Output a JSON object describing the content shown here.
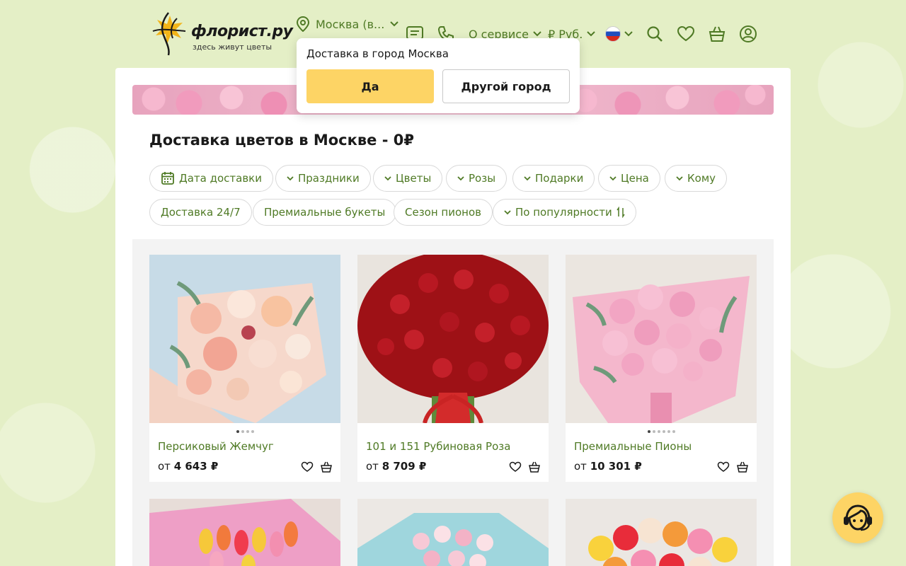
{
  "header": {
    "logo_text": "флорист.ру",
    "logo_tagline": "здесь живут цветы",
    "city_label": "Москва (в...",
    "about_label": "О сервисе",
    "currency_label": "₽ Руб."
  },
  "popup": {
    "question": "Доставка в город Москва",
    "yes_label": "Да",
    "other_label": "Другой город"
  },
  "main": {
    "title": "Доставка цветов в Москве - 0₽"
  },
  "filters": {
    "row1": [
      "Дата доставки",
      "Праздники",
      "Цветы",
      "Розы",
      "Подарки",
      "Цена",
      "Кому"
    ],
    "row2": [
      "Доставка 24/7",
      "Премиальные букеты",
      "Сезон пионов",
      "По популярности"
    ]
  },
  "products": [
    {
      "name": "Персиковый Жемчуг",
      "price_prefix": "от",
      "price": "4 643 ₽"
    },
    {
      "name": "101 и 151 Рубиновая Роза",
      "price_prefix": "от",
      "price": "8 709 ₽"
    },
    {
      "name": "Премиальные Пионы",
      "price_prefix": "от",
      "price": "10 301 ₽"
    }
  ],
  "colors": {
    "accent_green": "#4f7a25",
    "button_yellow": "#fdd465",
    "page_bg": "#e4efc6"
  },
  "icons": [
    "location-pin-icon",
    "chevron-down-icon",
    "chat-icon",
    "phone-icon",
    "flag-ru-icon",
    "search-icon",
    "heart-icon",
    "basket-icon",
    "user-icon",
    "calendar-icon",
    "sort-icon",
    "support-agent-icon"
  ]
}
